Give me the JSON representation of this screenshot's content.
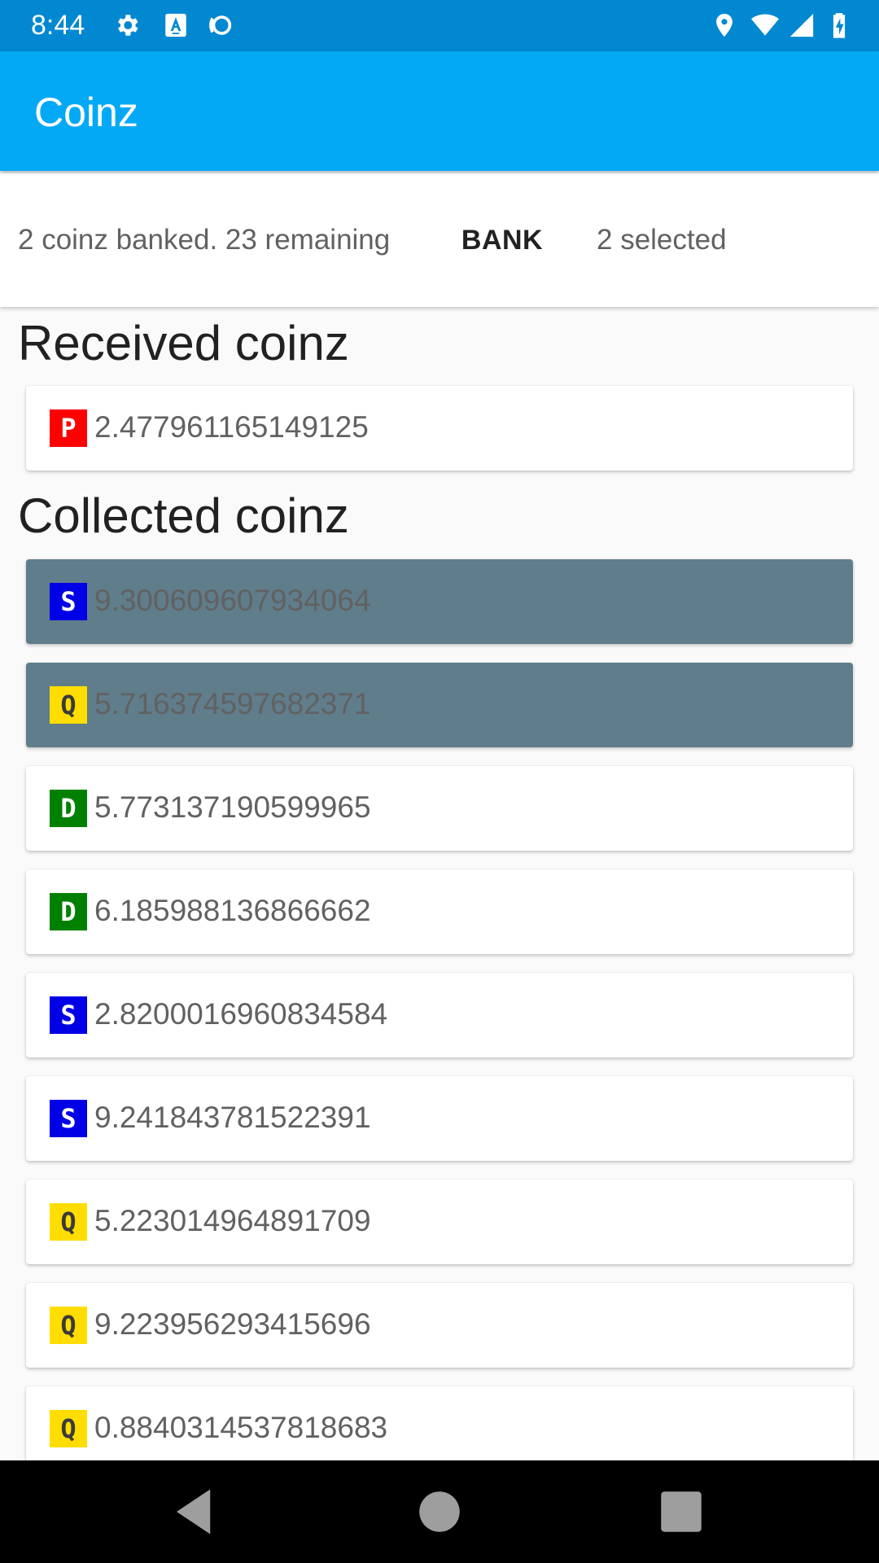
{
  "status_bar": {
    "time": "8:44",
    "left_icons": [
      "gear-icon",
      "text-a-icon",
      "sync-icon"
    ],
    "right_icons": [
      "location-icon",
      "wifi-icon",
      "signal-icon",
      "battery-icon"
    ]
  },
  "app_bar": {
    "title": "Coinz"
  },
  "bank_panel": {
    "status": "2 coinz banked. 23 remaining",
    "bank_button": "BANK",
    "selected": "2 selected"
  },
  "received": {
    "title": "Received coinz",
    "coins": [
      {
        "currency": "P",
        "value": "2.477961165149125",
        "color": "#ff0000",
        "selected": false
      }
    ]
  },
  "collected": {
    "title": "Collected coinz",
    "coins": [
      {
        "currency": "S",
        "value": "9.300609607934064",
        "color": "#0000e6",
        "selected": true
      },
      {
        "currency": "Q",
        "value": "5.716374597682371",
        "color": "#ffdd00",
        "selected": true
      },
      {
        "currency": "D",
        "value": "5.773137190599965",
        "color": "#008000",
        "selected": false
      },
      {
        "currency": "D",
        "value": "6.185988136866662",
        "color": "#008000",
        "selected": false
      },
      {
        "currency": "S",
        "value": "2.8200016960834584",
        "color": "#0000e6",
        "selected": false
      },
      {
        "currency": "S",
        "value": "9.241843781522391",
        "color": "#0000e6",
        "selected": false
      },
      {
        "currency": "Q",
        "value": "5.223014964891709",
        "color": "#ffdd00",
        "selected": false
      },
      {
        "currency": "Q",
        "value": "9.223956293415696",
        "color": "#ffdd00",
        "selected": false
      },
      {
        "currency": "Q",
        "value": "0.8840314537818683",
        "color": "#ffdd00",
        "selected": false
      }
    ]
  },
  "colors": {
    "status_bar": "#0288d1",
    "app_bar": "#03a9f4",
    "selected_card": "#607d8b"
  },
  "nav_bar": {
    "icons": [
      "back-icon",
      "home-icon",
      "recents-icon"
    ]
  }
}
